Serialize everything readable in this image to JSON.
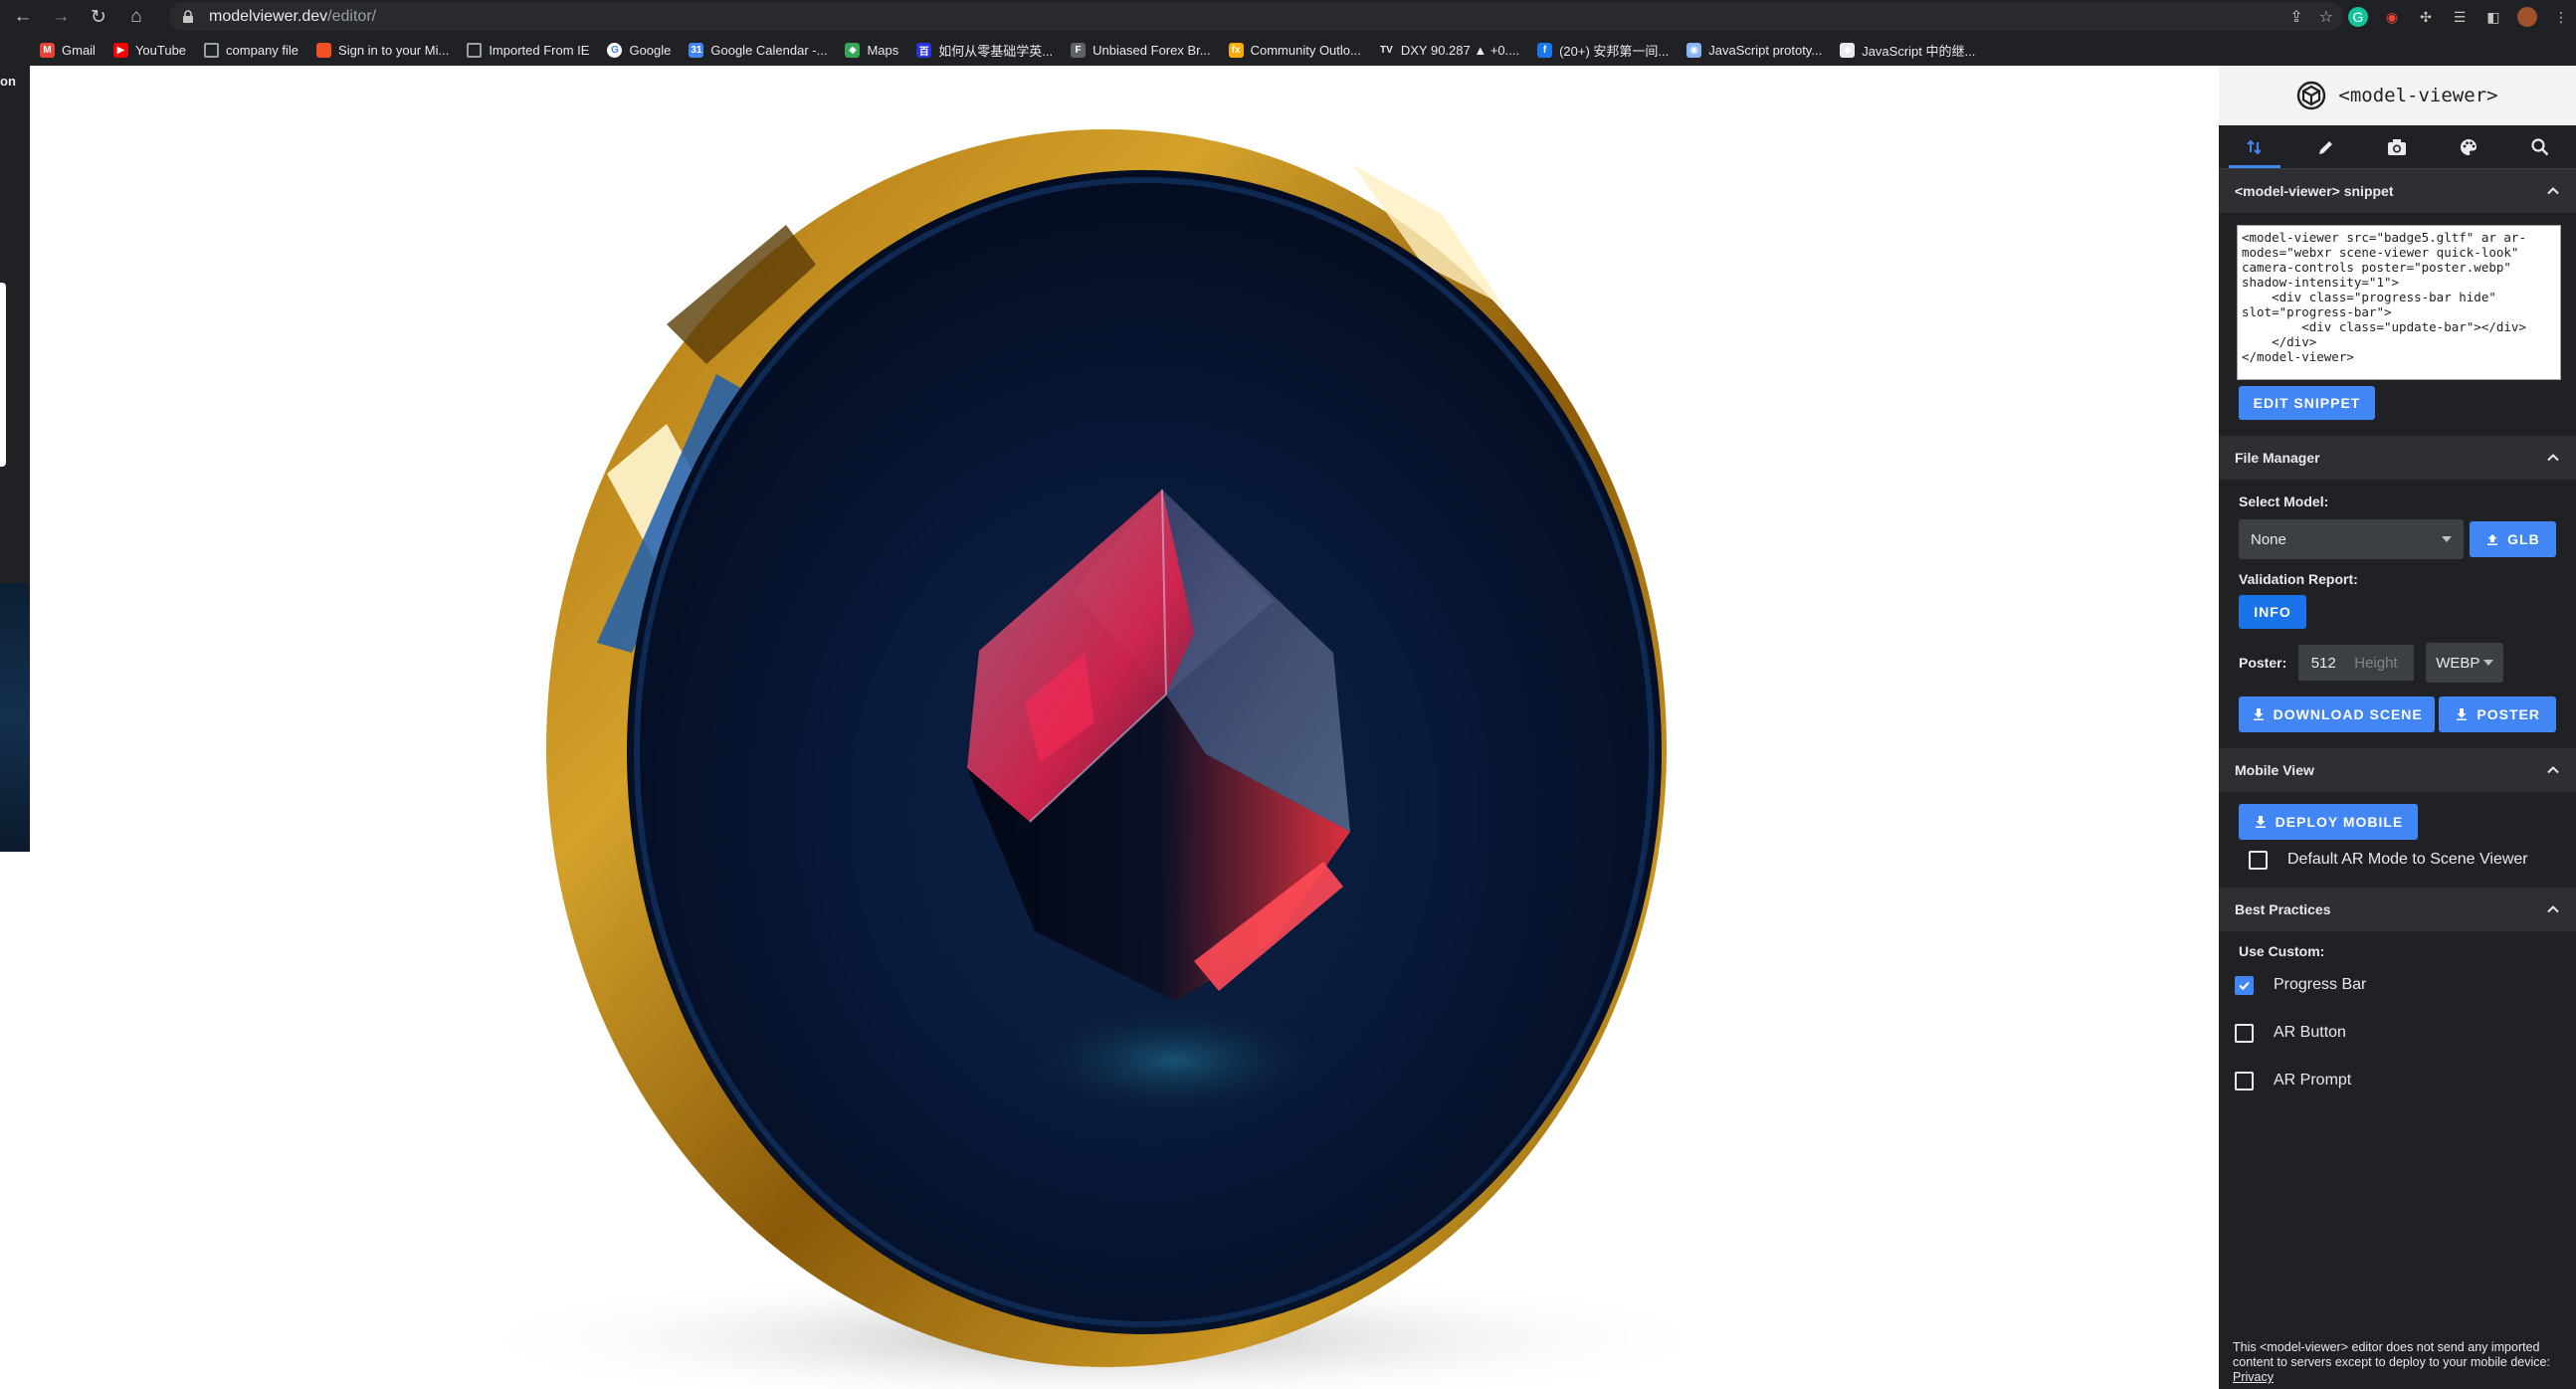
{
  "browser": {
    "url_host": "modelviewer.dev",
    "url_path": "/editor/",
    "bookmarks": [
      {
        "label": "Gmail",
        "icon": "gmail-icon",
        "color": "#ea4335",
        "glyph": "M"
      },
      {
        "label": "YouTube",
        "icon": "youtube-icon",
        "color": "#ff0000",
        "glyph": "▶"
      },
      {
        "label": "company file",
        "icon": "folder-icon",
        "color": "#9aa0a6",
        "glyph": ""
      },
      {
        "label": "Sign in to your Mi...",
        "icon": "microsoft-icon",
        "color": "#f25022",
        "glyph": ""
      },
      {
        "label": "Imported From IE",
        "icon": "folder-icon",
        "color": "#9aa0a6",
        "glyph": ""
      },
      {
        "label": "Google",
        "icon": "google-icon",
        "color": "#ffffff",
        "glyph": "G"
      },
      {
        "label": "Google Calendar -...",
        "icon": "calendar-icon",
        "color": "#4285f4",
        "glyph": "31"
      },
      {
        "label": "Maps",
        "icon": "maps-icon",
        "color": "#34a853",
        "glyph": "◆"
      },
      {
        "label": "如何从零基础学英...",
        "icon": "baidu-icon",
        "color": "#2932e1",
        "glyph": "百"
      },
      {
        "label": "Unbiased Forex Br...",
        "icon": "forex-icon",
        "color": "#5f6368",
        "glyph": "F"
      },
      {
        "label": "Community Outlo...",
        "icon": "fx-icon",
        "color": "#f9ab00",
        "glyph": "fx"
      },
      {
        "label": "DXY 90.287 ▲ +0....",
        "icon": "tradingview-icon",
        "color": "#202124",
        "glyph": "TV"
      },
      {
        "label": "(20+) 安邦第一间...",
        "icon": "facebook-icon",
        "color": "#1877f2",
        "glyph": "f"
      },
      {
        "label": "JavaScript prototy...",
        "icon": "globe-icon",
        "color": "#8ab4f8",
        "glyph": "◉"
      },
      {
        "label": "JavaScript 中的继...",
        "icon": "juejin-icon",
        "color": "#e8eaed",
        "glyph": "◆"
      }
    ],
    "sliver_text": "on"
  },
  "editor": {
    "title": "<model-viewer>",
    "tabs": [
      {
        "name": "tab-edit-order",
        "icon": "sort-arrows-icon",
        "active": true
      },
      {
        "name": "tab-edit",
        "icon": "pencil-icon",
        "active": false
      },
      {
        "name": "tab-camera",
        "icon": "camera-icon",
        "active": false
      },
      {
        "name": "tab-materials",
        "icon": "palette-icon",
        "active": false
      },
      {
        "name": "tab-inspect",
        "icon": "search-icon",
        "active": false
      }
    ],
    "snippet": {
      "title": "<model-viewer> snippet",
      "code": "<model-viewer src=\"badge5.gltf\" ar ar-modes=\"webxr scene-viewer quick-look\" camera-controls poster=\"poster.webp\" shadow-intensity=\"1\">\n    <div class=\"progress-bar hide\" slot=\"progress-bar\">\n        <div class=\"update-bar\"></div>\n    </div>\n</model-viewer>",
      "edit_button": "EDIT SNIPPET"
    },
    "file_manager": {
      "title": "File Manager",
      "select_model_label": "Select Model:",
      "select_model_value": "None",
      "glb_button": "GLB",
      "validation_label": "Validation Report:",
      "info_button": "INFO",
      "poster_label": "Poster:",
      "poster_width": "512",
      "poster_height_placeholder": "Height",
      "poster_format": "WEBP",
      "download_scene_button": "DOWNLOAD SCENE",
      "poster_button": "POSTER"
    },
    "mobile_view": {
      "title": "Mobile View",
      "deploy_button": "DEPLOY MOBILE",
      "ar_mode_label": "Default AR Mode to Scene Viewer",
      "ar_mode_checked": false
    },
    "best_practices": {
      "title": "Best Practices",
      "use_custom_label": "Use Custom:",
      "options": [
        {
          "label": "Progress Bar",
          "checked": true
        },
        {
          "label": "AR Button",
          "checked": false
        },
        {
          "label": "AR Prompt",
          "checked": false
        }
      ]
    },
    "footer": {
      "note": "This <model-viewer> editor does not send any imported content to servers except to deploy to your mobile device:",
      "privacy_link": "Privacy"
    }
  },
  "colors": {
    "accent": "#4285f4",
    "panel_bg": "#202124",
    "coin_rim": "#c8961e",
    "coin_face": "#0b1a3a"
  }
}
